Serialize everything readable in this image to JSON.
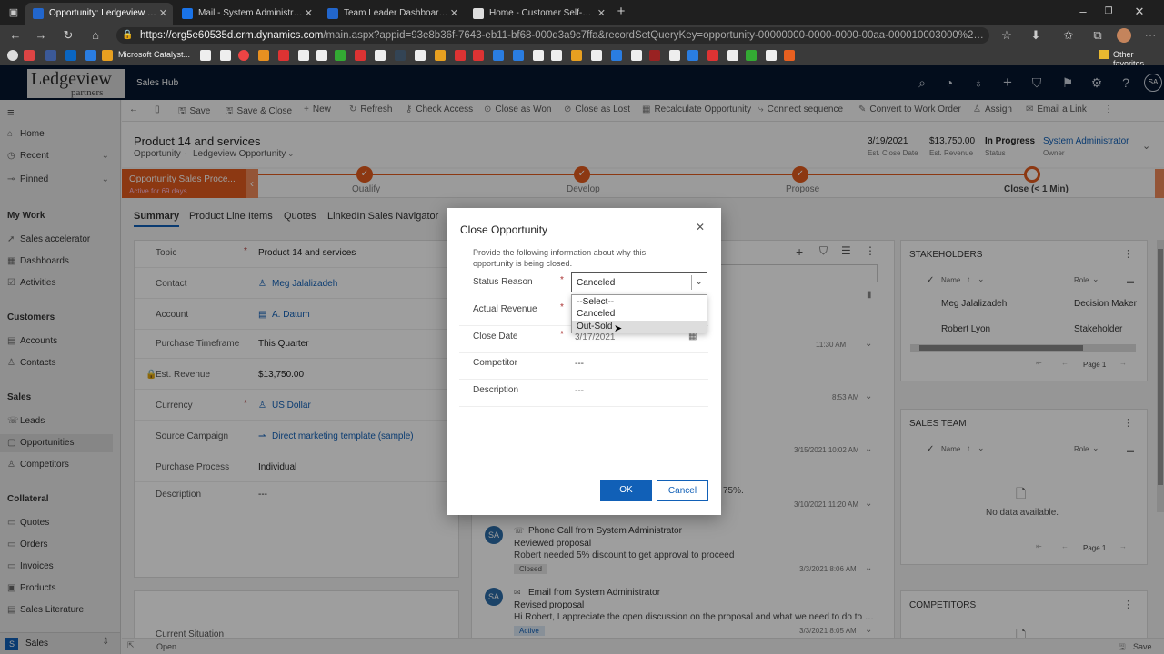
{
  "browser": {
    "tabs": [
      {
        "label": "Opportunity: Ledgeview Opportu"
      },
      {
        "label": "Mail - System Administrator - O"
      },
      {
        "label": "Team Leader Dashboard - Dyna"
      },
      {
        "label": "Home - Customer Self-Service"
      }
    ],
    "url_host": "https://org5e60535d.crm.dynamics.com",
    "url_path": "/main.aspx?appid=93e8b36f-7643-eb11-bf68-000d3a9c7ffa&recordSetQueryKey=opportunity-00000000-0000-0000-00aa-000010003000%253A%2520tran...",
    "favorites": {
      "microsoft_catalyst": "Microsoft Catalyst...",
      "other": "Other favorites"
    }
  },
  "app": {
    "logo_main": "Ledgeview",
    "logo_sub": "partners",
    "name": "Sales Hub",
    "avatar": "SA"
  },
  "sidebar": {
    "top": [
      {
        "label": "Home",
        "icon": "home-icon"
      },
      {
        "label": "Recent",
        "icon": "clock-icon"
      },
      {
        "label": "Pinned",
        "icon": "pin-icon"
      }
    ],
    "sections": [
      {
        "title": "My Work",
        "items": [
          "Sales accelerator",
          "Dashboards",
          "Activities"
        ]
      },
      {
        "title": "Customers",
        "items": [
          "Accounts",
          "Contacts"
        ]
      },
      {
        "title": "Sales",
        "items": [
          "Leads",
          "Opportunities",
          "Competitors"
        ]
      },
      {
        "title": "Collateral",
        "items": [
          "Quotes",
          "Orders",
          "Invoices",
          "Products",
          "Sales Literature"
        ]
      }
    ],
    "area_badge": "S",
    "area": "Sales"
  },
  "commands": [
    "Save",
    "Save & Close",
    "New",
    "Refresh",
    "Check Access",
    "Close as Won",
    "Close as Lost",
    "Recalculate Opportunity",
    "Connect sequence",
    "Convert to Work Order",
    "Assign",
    "Email a Link"
  ],
  "record": {
    "title": "Product 14 and services",
    "entity": "Opportunity",
    "form": "Ledgeview Opportunity",
    "close_date": "3/19/2021",
    "close_date_label": "Est. Close Date",
    "revenue": "$13,750.00",
    "revenue_label": "Est. Revenue",
    "status": "In Progress",
    "status_label": "Status",
    "owner": "System Administrator",
    "owner_label": "Owner"
  },
  "bpf": {
    "name": "Opportunity Sales Proce...",
    "active": "Active for 69 days",
    "stages": [
      "Qualify",
      "Develop",
      "Propose",
      "Close  (< 1 Min)"
    ]
  },
  "form_tabs": [
    "Summary",
    "Product Line Items",
    "Quotes",
    "LinkedIn Sales Navigator"
  ],
  "fields": [
    {
      "label": "Topic",
      "value": "Product 14 and services",
      "req": "*"
    },
    {
      "label": "Contact",
      "value": "Meg Jalalizadeh",
      "req": ""
    },
    {
      "label": "Account",
      "value": "A. Datum",
      "req": ""
    },
    {
      "label": "Purchase Timeframe",
      "value": "This Quarter",
      "req": ""
    },
    {
      "label": "Est. Revenue",
      "value": "$13,750.00",
      "req": ""
    },
    {
      "label": "Currency",
      "value": "US Dollar",
      "req": "*"
    },
    {
      "label": "Source Campaign",
      "value": "Direct marketing template (sample)",
      "req": ""
    },
    {
      "label": "Purchase Process",
      "value": "Individual",
      "req": ""
    },
    {
      "label": "Description",
      "value": "---",
      "req": ""
    }
  ],
  "current_situation": "Current Situation",
  "timeline": {
    "times": [
      "11:30 AM",
      "8:53 AM",
      "3/15/2021 10:02 AM",
      "3/10/2021 11:20 AM",
      "3/3/2021 8:06 AM",
      "3/3/2021 8:05 AM"
    ],
    "snippet": "75%.",
    "items": [
      {
        "avatar": "SA",
        "title": "Phone Call from System Administrator",
        "subject": "Reviewed proposal",
        "body": "Robert needed 5% discount to get approval to proceed",
        "badge": "Closed"
      },
      {
        "avatar": "SA",
        "title": "Email from System Administrator",
        "subject": "Revised proposal",
        "body": "Hi Robert, I appreciate the open discussion on the proposal and what we need to do to win y...",
        "badge": "Active"
      }
    ]
  },
  "stakeholders": {
    "title": "STAKEHOLDERS",
    "col_name": "Name",
    "col_role": "Role",
    "rows": [
      {
        "name": "Meg Jalalizadeh",
        "role": "Decision Maker"
      },
      {
        "name": "Robert Lyon",
        "role": "Stakeholder"
      }
    ],
    "page": "Page 1"
  },
  "sales_team": {
    "title": "SALES TEAM",
    "col_name": "Name",
    "col_role": "Role",
    "empty": "No data available.",
    "page": "Page 1"
  },
  "competitors_title": "COMPETITORS",
  "footer": {
    "status": "Open",
    "save": "Save"
  },
  "dialog": {
    "title": "Close Opportunity",
    "intro": "Provide the following information about why this opportunity is being closed.",
    "status_reason_label": "Status Reason",
    "status_reason_value": "Canceled",
    "options": [
      "--Select--",
      "Canceled",
      "Out-Sold"
    ],
    "actual_revenue_label": "Actual Revenue",
    "close_date_label": "Close Date",
    "close_date_value": "3/17/2021",
    "competitor_label": "Competitor",
    "competitor_value": "---",
    "description_label": "Description",
    "description_value": "---",
    "required_marker": "*",
    "ok": "OK",
    "cancel": "Cancel"
  }
}
